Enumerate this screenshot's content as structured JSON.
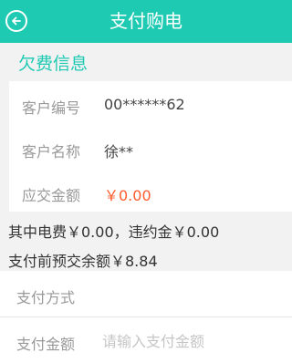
{
  "header": {
    "title": "支付购电",
    "back_icon": "back-arrow-circle-icon",
    "background_color": "#1fcab3"
  },
  "arrears_section": {
    "title": "欠费信息"
  },
  "info": {
    "customer_number_label": "客户编号",
    "customer_number_value": "00******62",
    "customer_name_label": "客户名称",
    "customer_name_value": "徐**",
    "amount_due_label": "应交金额",
    "amount_due_value": "￥0.00",
    "amount_due_color": "#ff5b2e"
  },
  "summary": {
    "line1": "其中电费￥0.00，违约金￥0.00",
    "line2": "支付前预交余额￥8.84"
  },
  "form": {
    "payment_method_label": "支付方式",
    "payment_amount_label": "支付金额",
    "payment_amount_placeholder": "请输入支付金额",
    "payment_amount_value": ""
  }
}
